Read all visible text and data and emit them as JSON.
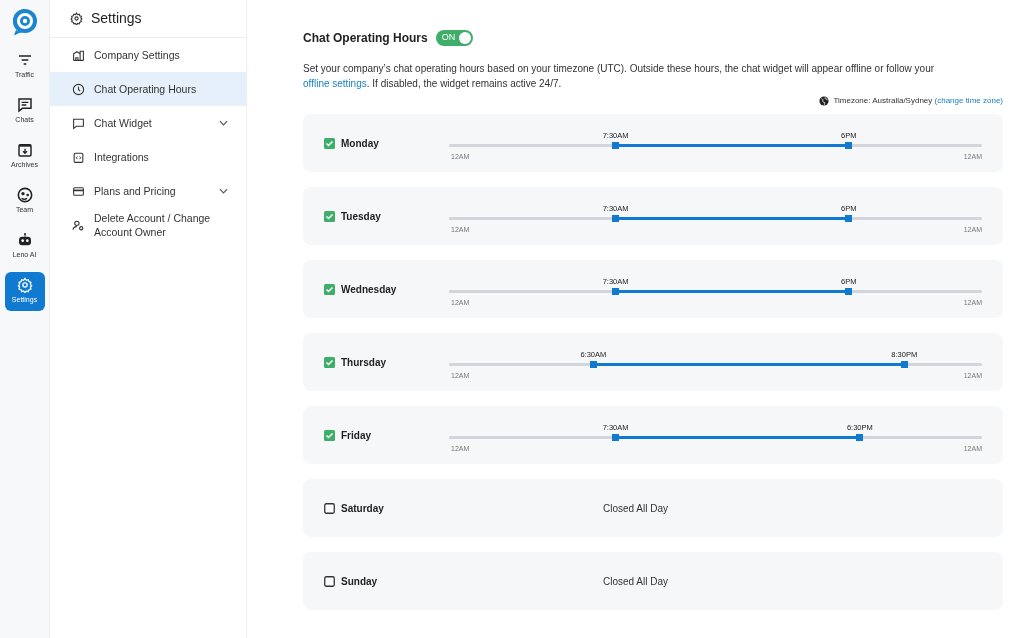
{
  "rail": [
    {
      "label": "Traffic",
      "selected": false
    },
    {
      "label": "Chats",
      "selected": false
    },
    {
      "label": "Archives",
      "selected": false
    },
    {
      "label": "Team",
      "selected": false
    },
    {
      "label": "Leno AI",
      "selected": false
    },
    {
      "label": "Settings",
      "selected": true
    }
  ],
  "sidebar": {
    "title": "Settings",
    "items": [
      {
        "label": "Company Settings",
        "kind": "link",
        "selected": false
      },
      {
        "label": "Chat Operating Hours",
        "kind": "link",
        "selected": true
      },
      {
        "label": "Chat Widget",
        "kind": "menu",
        "selected": false
      },
      {
        "label": "Integrations",
        "kind": "link",
        "selected": false
      },
      {
        "label": "Plans and Pricing",
        "kind": "menu",
        "selected": false
      },
      {
        "label": "Delete Account / Change Account Owner",
        "kind": "link",
        "selected": false
      }
    ]
  },
  "header": {
    "title": "Chat Operating Hours",
    "toggle": {
      "label": "ON",
      "on": true
    }
  },
  "description": {
    "before": "Set your company’s chat operating hours based on your timezone (UTC). Outside these hours, the chat widget will appear offline or follow your",
    "link": "offline settings",
    "after": ". If disabled, the widget remains active 24/7."
  },
  "timezone": {
    "label": "Timezone: Australia/Sydney",
    "link": "(change time zone)"
  },
  "days": [
    {
      "name": "Monday",
      "checked": true,
      "start": {
        "label": "7:30AM",
        "level": 0.3125
      },
      "end": {
        "label": "6PM",
        "level": 0.75
      },
      "min_label": "12AM",
      "max_label": "12AM"
    },
    {
      "name": "Tuesday",
      "checked": true,
      "start": {
        "label": "7:30AM",
        "level": 0.3125
      },
      "end": {
        "label": "6PM",
        "level": 0.75
      },
      "min_label": "12AM",
      "max_label": "12AM"
    },
    {
      "name": "Wednesday",
      "checked": true,
      "start": {
        "label": "7:30AM",
        "level": 0.3125
      },
      "end": {
        "label": "6PM",
        "level": 0.75
      },
      "min_label": "12AM",
      "max_label": "12AM"
    },
    {
      "name": "Thursday",
      "checked": true,
      "start": {
        "label": "6:30AM",
        "level": 0.2708
      },
      "end": {
        "label": "8:30PM",
        "level": 0.8542
      },
      "min_label": "12AM",
      "max_label": "12AM"
    },
    {
      "name": "Friday",
      "checked": true,
      "start": {
        "label": "7:30AM",
        "level": 0.3125
      },
      "end": {
        "label": "6:30PM",
        "level": 0.7708
      },
      "min_label": "12AM",
      "max_label": "12AM"
    },
    {
      "name": "Saturday",
      "checked": false,
      "closed_text": "Closed All Day"
    },
    {
      "name": "Sunday",
      "checked": false,
      "closed_text": "Closed All Day"
    }
  ]
}
